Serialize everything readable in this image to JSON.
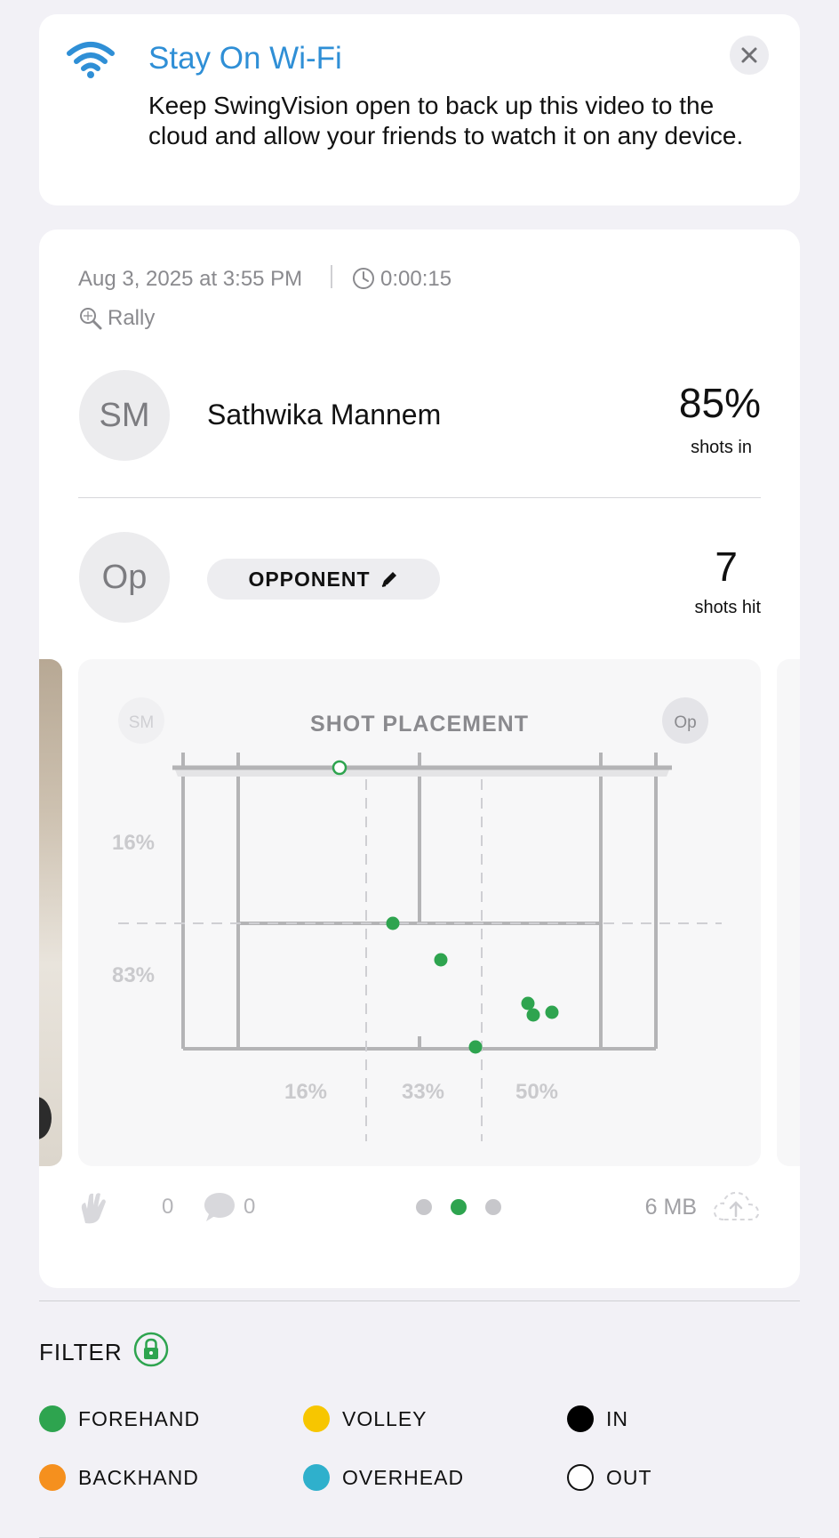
{
  "banner": {
    "title": "Stay On Wi-Fi",
    "body": "Keep SwingVision open to back up this video to the cloud and allow your friends to watch it on any device.",
    "icon": "wifi-icon",
    "close_icon": "close-icon",
    "accent": "#2f8fd6"
  },
  "session": {
    "date": "Aug 3, 2025 at 3:55 PM",
    "duration": "0:00:15",
    "type": "Rally",
    "player": {
      "initials": "SM",
      "name": "Sathwika Mannem",
      "stat_value": "85%",
      "stat_label": "shots in"
    },
    "opponent": {
      "initials": "Op",
      "label": "OPPONENT",
      "stat_value": "7",
      "stat_label": "shots hit"
    }
  },
  "placement": {
    "title": "SHOT PLACEMENT",
    "left_avatar": "SM",
    "right_avatar": "Op",
    "depth_percents": [
      "16%",
      "83%"
    ],
    "width_percents": [
      "16%",
      "33%",
      "50%"
    ],
    "dot_color": "#2ea44f"
  },
  "footer": {
    "claps": "0",
    "comments": "0",
    "page_index": 1,
    "page_count": 3,
    "size": "6 MB"
  },
  "filter": {
    "title": "FILTER",
    "items": [
      {
        "label": "FOREHAND",
        "color": "#2ea44f"
      },
      {
        "label": "VOLLEY",
        "color": "#f7c600"
      },
      {
        "label": "IN",
        "color": "#000000"
      },
      {
        "label": "BACKHAND",
        "color": "#f5901e"
      },
      {
        "label": "OVERHEAD",
        "color": "#2fb0cc"
      },
      {
        "label": "OUT",
        "color": "outline"
      }
    ]
  }
}
